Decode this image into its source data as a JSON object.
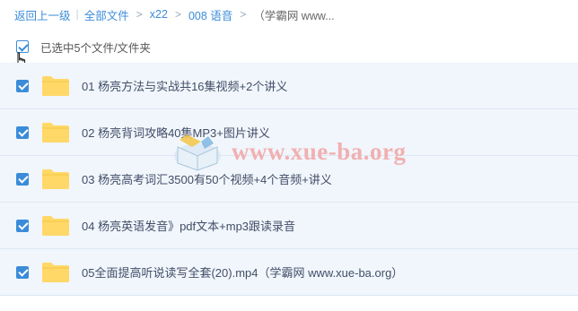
{
  "breadcrumb": {
    "back": "返回上一级",
    "all_files": "全部文件",
    "crumbs": [
      "x22",
      "008 语音"
    ],
    "current": "（学霸网 www..."
  },
  "selection": {
    "label": "已选中5个文件/文件夹"
  },
  "files": [
    {
      "name": "01 杨亮方法与实战共16集视频+2个讲义",
      "icon": "folder-icon",
      "checked": true
    },
    {
      "name": "02 杨亮背词攻略40集MP3+图片讲义",
      "icon": "folder-icon",
      "checked": true
    },
    {
      "name": "03 杨亮高考词汇3500有50个视频+4个音频+讲义",
      "icon": "folder-icon",
      "checked": true
    },
    {
      "name": "04 杨亮英语发音》pdf文本+mp3跟读录音",
      "icon": "folder-icon",
      "checked": true
    },
    {
      "name": "05全面提高听说读写全套(20).mp4（学霸网 www.xue-ba.org）",
      "icon": "folder-icon",
      "checked": true
    }
  ],
  "watermark": {
    "text": "www.xue-ba.org",
    "icon": "book-logo-icon"
  },
  "colors": {
    "accent": "#3b8cd8",
    "row_bg": "#f1f6fc",
    "folder": "#ffd867",
    "watermark": "#f2a9a9"
  }
}
